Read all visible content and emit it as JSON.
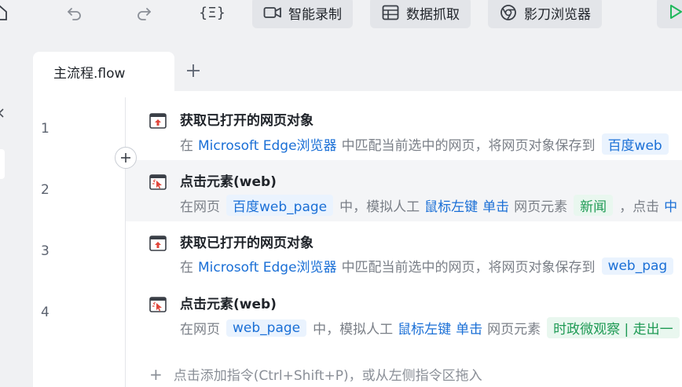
{
  "toolbar": {
    "icons": [
      "home-icon",
      "undo-icon",
      "redo-icon",
      "variable-icon"
    ],
    "variable_glyph": "{Ξ}",
    "buttons": [
      {
        "label": "智能录制",
        "icon": "video-camera-icon"
      },
      {
        "label": "数据抓取",
        "icon": "table-icon"
      },
      {
        "label": "影刀浏览器",
        "icon": "browser-icon"
      }
    ],
    "run_icon": "play-icon",
    "run_color": "#1fb85c"
  },
  "tabs": {
    "active_label": "主流程.flow",
    "add_glyph": "+"
  },
  "flow": {
    "line_numbers": [
      "1",
      "2",
      "3",
      "4"
    ],
    "steps": [
      {
        "title": "获取已打开的网页对象",
        "icon": "browser-open-icon",
        "desc": {
          "p1": "在",
          "link": "Microsoft Edge浏览器",
          "p2": "中匹配当前选中的网页，将网页对象保存到",
          "var": "百度web"
        }
      },
      {
        "title": "点击元素(web)",
        "icon": "click-element-icon",
        "desc": {
          "p1": "在网页",
          "var": "百度web_page",
          "p2": "中，模拟人工",
          "link1": "鼠标左键",
          "link2": "单击",
          "p3": "网页元素",
          "elem": "新闻",
          "p4": "，点击",
          "tail": "中"
        }
      },
      {
        "title": "获取已打开的网页对象",
        "icon": "browser-open-icon",
        "desc": {
          "p1": "在",
          "link": "Microsoft Edge浏览器",
          "p2": "中匹配当前选中的网页，将网页对象保存到",
          "var": "web_pag"
        }
      },
      {
        "title": "点击元素(web)",
        "icon": "click-element-icon",
        "desc": {
          "p1": "在网页",
          "var": "web_page",
          "p2": "中，模拟人工",
          "link1": "鼠标左键",
          "link2": "单击",
          "p3": "网页元素",
          "elem": "时政微观察 | 走出一"
        }
      }
    ],
    "add_hint": "点击添加指令(Ctrl+Shift+P)，或从左侧指令区拖入",
    "add_hint_glyph": "+"
  },
  "left_panel": {
    "collapse_glyph": "《"
  },
  "colors": {
    "accent": "#1a6fd6",
    "element_green": "#1e9a54",
    "highlight_row": "#f4f5f7"
  }
}
